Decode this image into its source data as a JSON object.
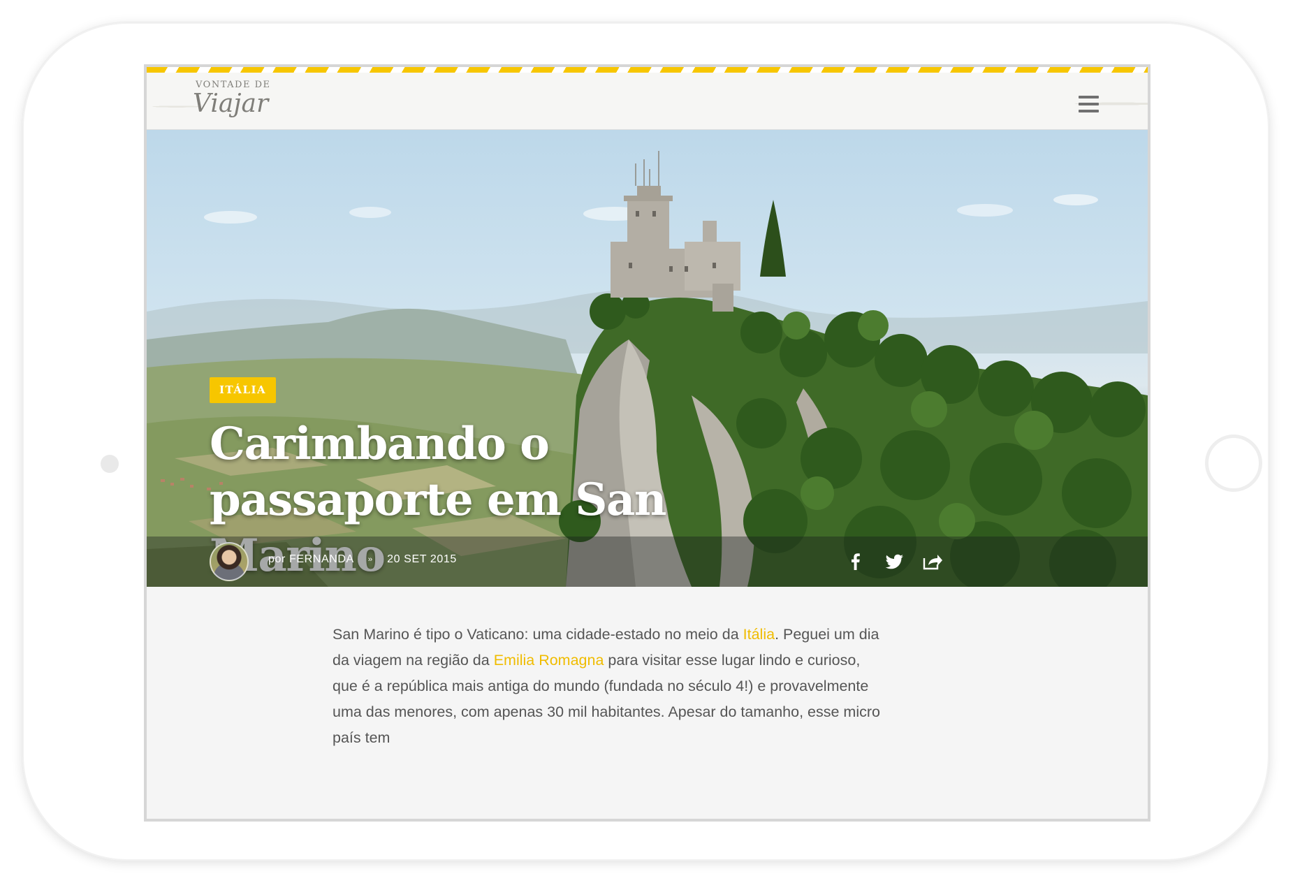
{
  "header": {
    "logo_small": "VONTADE DE",
    "logo_main": "Viajar",
    "menu_icon": "hamburger-menu-icon"
  },
  "post": {
    "category": "ITÁLIA",
    "title": "Carimbando o passaporte em San Marino",
    "author_prefix": "por",
    "author": "FERNANDA",
    "separator": "››",
    "date": "20 SET 2015",
    "share_icons": [
      "facebook-icon",
      "twitter-icon",
      "share-icon"
    ]
  },
  "article": {
    "p1_part1": "San Marino é tipo o Vaticano: uma cidade-estado no meio da ",
    "link1": "Itália",
    "p1_part2": ". Peguei um dia da viagem na região da ",
    "link2": "Emilia Romagna",
    "p1_part3": " para visitar esse lugar lindo e curioso, que é a república mais antiga do mundo (fundada no século 4!) e provavelmente uma das menores, com apenas 30 mil habitantes. Apesar do tamanho, esse micro país tem"
  },
  "colors": {
    "accent": "#f7c600",
    "link": "#f0bc00",
    "text": "#555555",
    "page_bg": "#f5f5f5"
  }
}
